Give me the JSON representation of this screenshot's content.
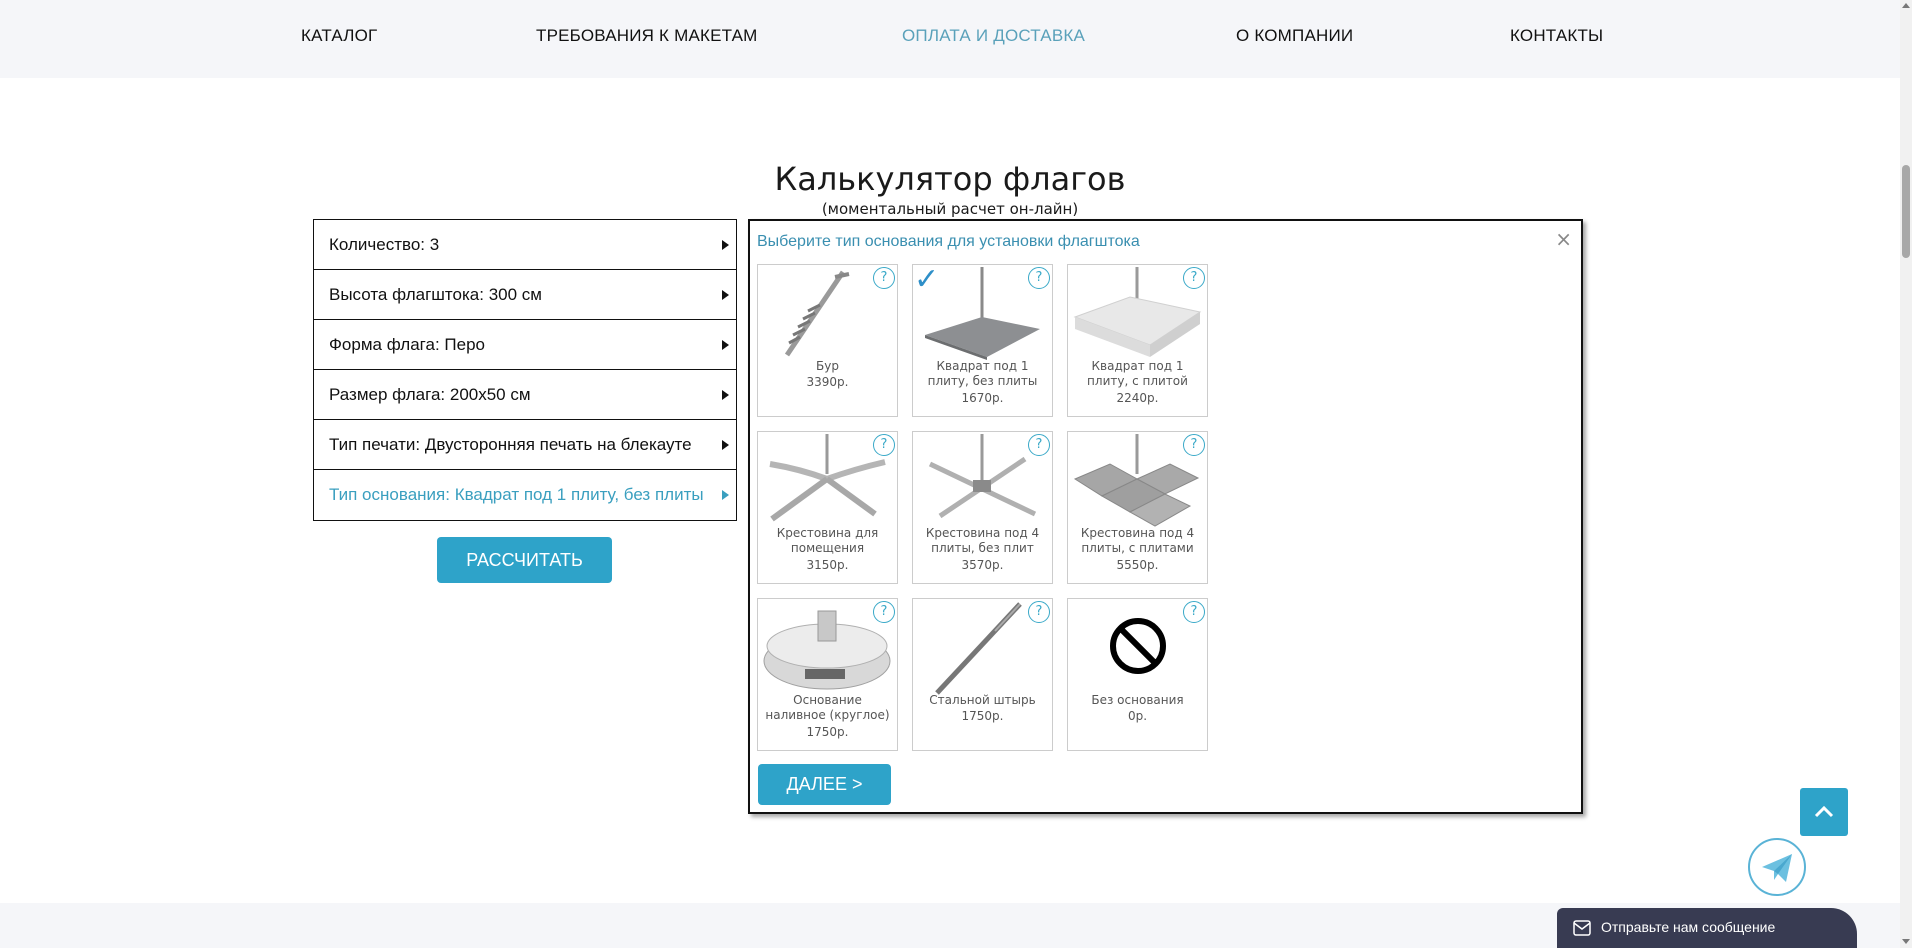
{
  "nav": {
    "items": [
      {
        "label": "КАТАЛОГ",
        "active": false
      },
      {
        "label": "ТРЕБОВАНИЯ К МАКЕТАМ",
        "active": false
      },
      {
        "label": "ОПЛАТА И ДОСТАВКА",
        "active": true
      },
      {
        "label": "О КОМПАНИИ",
        "active": false
      },
      {
        "label": "КОНТАКТЫ",
        "active": false
      }
    ]
  },
  "calculator": {
    "title": "Калькулятор флагов",
    "subtitle": "(моментальный расчет он-лайн)",
    "params": [
      {
        "label": "Количество: 3"
      },
      {
        "label": "Высота флагштока: 300 см"
      },
      {
        "label": "Форма флага: Перо"
      },
      {
        "label": "Размер флага: 200x50 см"
      },
      {
        "label": "Тип печати: Двусторонняя печать на блекауте"
      },
      {
        "label": "Тип основания: Квадрат под 1 плиту, без плиты"
      }
    ],
    "calculate_label": "РАССЧИТАТЬ"
  },
  "popup": {
    "title": "Выберите тип основания для установки флагштока",
    "close_glyph": "×",
    "help_glyph": "?",
    "check_glyph": "✓",
    "next_label": "ДАЛЕЕ >",
    "options": [
      {
        "name": "Бур",
        "price": "3390р.",
        "selected": false,
        "icon": "ground-screw-icon"
      },
      {
        "name": "Квадрат под 1 плиту, без плиты",
        "price": "1670р.",
        "selected": true,
        "icon": "square-base-icon"
      },
      {
        "name": "Квадрат под 1 плиту, с плитой",
        "price": "2240р.",
        "selected": false,
        "icon": "square-base-slab-icon"
      },
      {
        "name": "Крестовина для помещения",
        "price": "3150р.",
        "selected": false,
        "icon": "indoor-cross-base-icon"
      },
      {
        "name": "Крестовина под 4 плиты, без плит",
        "price": "3570р.",
        "selected": false,
        "icon": "cross-base-icon"
      },
      {
        "name": "Крестовина под 4 плиты, с плитами",
        "price": "5550р.",
        "selected": false,
        "icon": "cross-base-slabs-icon"
      },
      {
        "name": "Основание наливное (круглое)",
        "price": "1750р.",
        "selected": false,
        "icon": "water-base-icon"
      },
      {
        "name": "Стальной штырь",
        "price": "1750р.",
        "selected": false,
        "icon": "steel-pin-icon"
      },
      {
        "name": "Без основания",
        "price": "0р.",
        "selected": false,
        "icon": "no-base-icon"
      }
    ]
  },
  "widgets": {
    "chat_label": "Отправьте нам сообщение"
  },
  "colors": {
    "accent": "#2ea3c9",
    "nav_active": "#5aa1ba",
    "chat_bg": "#383b52"
  }
}
